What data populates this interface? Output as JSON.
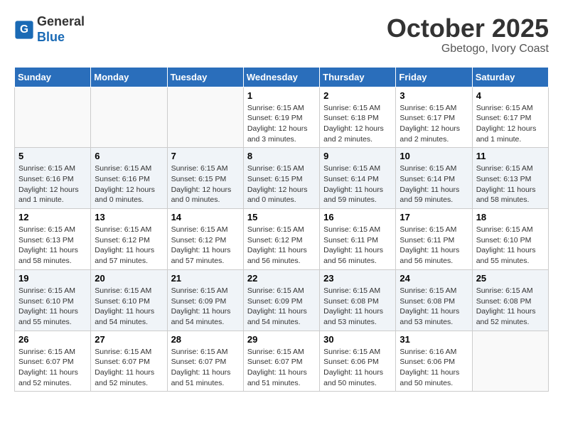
{
  "header": {
    "logo_line1": "General",
    "logo_line2": "Blue",
    "month": "October 2025",
    "location": "Gbetogo, Ivory Coast"
  },
  "weekdays": [
    "Sunday",
    "Monday",
    "Tuesday",
    "Wednesday",
    "Thursday",
    "Friday",
    "Saturday"
  ],
  "weeks": [
    [
      {
        "day": "",
        "info": ""
      },
      {
        "day": "",
        "info": ""
      },
      {
        "day": "",
        "info": ""
      },
      {
        "day": "1",
        "info": "Sunrise: 6:15 AM\nSunset: 6:19 PM\nDaylight: 12 hours and 3 minutes."
      },
      {
        "day": "2",
        "info": "Sunrise: 6:15 AM\nSunset: 6:18 PM\nDaylight: 12 hours and 2 minutes."
      },
      {
        "day": "3",
        "info": "Sunrise: 6:15 AM\nSunset: 6:17 PM\nDaylight: 12 hours and 2 minutes."
      },
      {
        "day": "4",
        "info": "Sunrise: 6:15 AM\nSunset: 6:17 PM\nDaylight: 12 hours and 1 minute."
      }
    ],
    [
      {
        "day": "5",
        "info": "Sunrise: 6:15 AM\nSunset: 6:16 PM\nDaylight: 12 hours and 1 minute."
      },
      {
        "day": "6",
        "info": "Sunrise: 6:15 AM\nSunset: 6:16 PM\nDaylight: 12 hours and 0 minutes."
      },
      {
        "day": "7",
        "info": "Sunrise: 6:15 AM\nSunset: 6:15 PM\nDaylight: 12 hours and 0 minutes."
      },
      {
        "day": "8",
        "info": "Sunrise: 6:15 AM\nSunset: 6:15 PM\nDaylight: 12 hours and 0 minutes."
      },
      {
        "day": "9",
        "info": "Sunrise: 6:15 AM\nSunset: 6:14 PM\nDaylight: 11 hours and 59 minutes."
      },
      {
        "day": "10",
        "info": "Sunrise: 6:15 AM\nSunset: 6:14 PM\nDaylight: 11 hours and 59 minutes."
      },
      {
        "day": "11",
        "info": "Sunrise: 6:15 AM\nSunset: 6:13 PM\nDaylight: 11 hours and 58 minutes."
      }
    ],
    [
      {
        "day": "12",
        "info": "Sunrise: 6:15 AM\nSunset: 6:13 PM\nDaylight: 11 hours and 58 minutes."
      },
      {
        "day": "13",
        "info": "Sunrise: 6:15 AM\nSunset: 6:12 PM\nDaylight: 11 hours and 57 minutes."
      },
      {
        "day": "14",
        "info": "Sunrise: 6:15 AM\nSunset: 6:12 PM\nDaylight: 11 hours and 57 minutes."
      },
      {
        "day": "15",
        "info": "Sunrise: 6:15 AM\nSunset: 6:12 PM\nDaylight: 11 hours and 56 minutes."
      },
      {
        "day": "16",
        "info": "Sunrise: 6:15 AM\nSunset: 6:11 PM\nDaylight: 11 hours and 56 minutes."
      },
      {
        "day": "17",
        "info": "Sunrise: 6:15 AM\nSunset: 6:11 PM\nDaylight: 11 hours and 56 minutes."
      },
      {
        "day": "18",
        "info": "Sunrise: 6:15 AM\nSunset: 6:10 PM\nDaylight: 11 hours and 55 minutes."
      }
    ],
    [
      {
        "day": "19",
        "info": "Sunrise: 6:15 AM\nSunset: 6:10 PM\nDaylight: 11 hours and 55 minutes."
      },
      {
        "day": "20",
        "info": "Sunrise: 6:15 AM\nSunset: 6:10 PM\nDaylight: 11 hours and 54 minutes."
      },
      {
        "day": "21",
        "info": "Sunrise: 6:15 AM\nSunset: 6:09 PM\nDaylight: 11 hours and 54 minutes."
      },
      {
        "day": "22",
        "info": "Sunrise: 6:15 AM\nSunset: 6:09 PM\nDaylight: 11 hours and 54 minutes."
      },
      {
        "day": "23",
        "info": "Sunrise: 6:15 AM\nSunset: 6:08 PM\nDaylight: 11 hours and 53 minutes."
      },
      {
        "day": "24",
        "info": "Sunrise: 6:15 AM\nSunset: 6:08 PM\nDaylight: 11 hours and 53 minutes."
      },
      {
        "day": "25",
        "info": "Sunrise: 6:15 AM\nSunset: 6:08 PM\nDaylight: 11 hours and 52 minutes."
      }
    ],
    [
      {
        "day": "26",
        "info": "Sunrise: 6:15 AM\nSunset: 6:07 PM\nDaylight: 11 hours and 52 minutes."
      },
      {
        "day": "27",
        "info": "Sunrise: 6:15 AM\nSunset: 6:07 PM\nDaylight: 11 hours and 52 minutes."
      },
      {
        "day": "28",
        "info": "Sunrise: 6:15 AM\nSunset: 6:07 PM\nDaylight: 11 hours and 51 minutes."
      },
      {
        "day": "29",
        "info": "Sunrise: 6:15 AM\nSunset: 6:07 PM\nDaylight: 11 hours and 51 minutes."
      },
      {
        "day": "30",
        "info": "Sunrise: 6:15 AM\nSunset: 6:06 PM\nDaylight: 11 hours and 50 minutes."
      },
      {
        "day": "31",
        "info": "Sunrise: 6:16 AM\nSunset: 6:06 PM\nDaylight: 11 hours and 50 minutes."
      },
      {
        "day": "",
        "info": ""
      }
    ]
  ]
}
